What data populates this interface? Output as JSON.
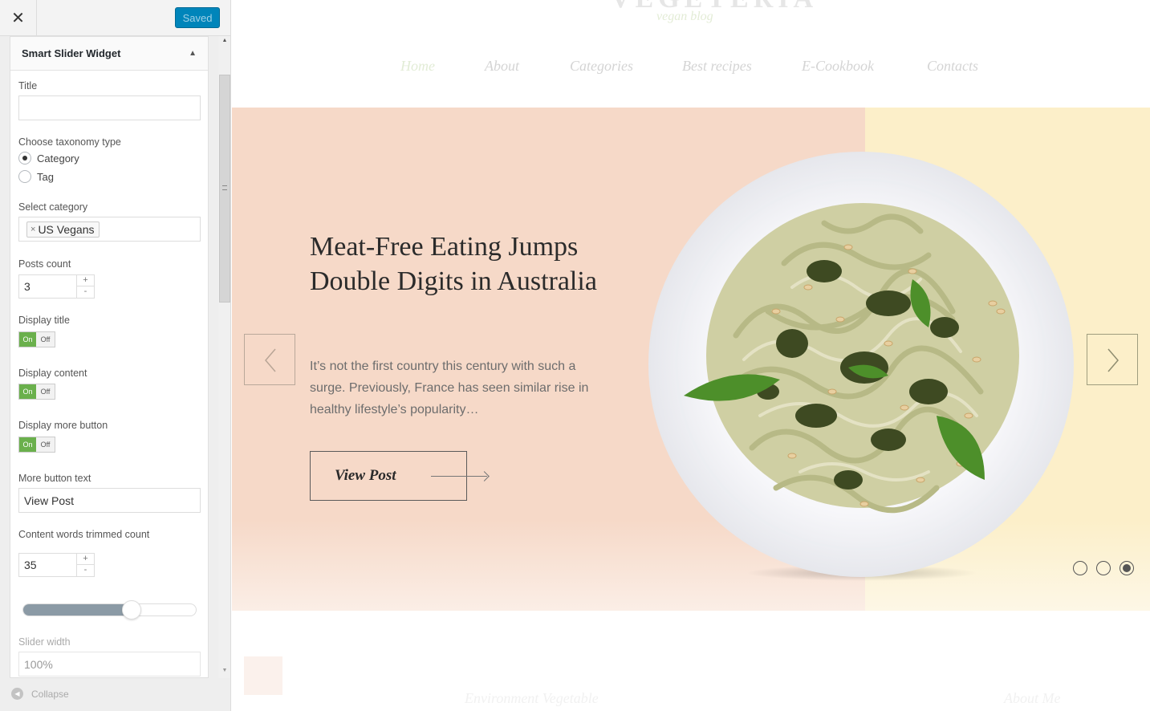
{
  "customizer": {
    "close_icon": "close-icon",
    "saved_label": "Saved",
    "widget_title": "Smart Slider Widget",
    "fields": {
      "title_label": "Title",
      "title_value": "",
      "taxonomy_label": "Choose taxonomy type",
      "taxonomy_options": [
        "Category",
        "Tag"
      ],
      "taxonomy_selected": "Category",
      "category_label": "Select category",
      "category_chip_remove": "×",
      "category_chip": "US Vegans",
      "posts_count_label": "Posts count",
      "posts_count_value": "3",
      "display_title_label": "Display title",
      "display_content_label": "Display content",
      "display_more_label": "Display more button",
      "switch_on": "On",
      "switch_off": "Off",
      "more_text_label": "More button text",
      "more_text_value": "View Post",
      "trim_label": "Content words trimmed count",
      "trim_value": "35",
      "stepper_plus": "+",
      "stepper_minus": "-",
      "slider_level": 0.63,
      "slider_width_label": "Slider width",
      "slider_width_value": "100%"
    },
    "collapse_label": "Collapse"
  },
  "site": {
    "tagline": "vegan blog",
    "nav": [
      "Home",
      "About",
      "Categories",
      "Best recipes",
      "E-Cookbook",
      "Contacts"
    ],
    "active_nav": "Home"
  },
  "slide": {
    "headline": "Meat-Free Eating Jumps Double Digits in Australia",
    "excerpt": "It’s not the first country this century with such a surge. Previously, France has seen similar rise in healthy lifestyle’s popularity…",
    "button_label": "View Post",
    "current_slide": 3,
    "total_slides": 3
  },
  "below": {
    "section_1": "Environment Vegetable",
    "section_2": "About Me"
  },
  "colors": {
    "saved_button": "#0085ba",
    "switch_on": "#6ab04c",
    "hero_left_bg": "#f6d9c8",
    "hero_right_bg": "#fcefc9"
  }
}
